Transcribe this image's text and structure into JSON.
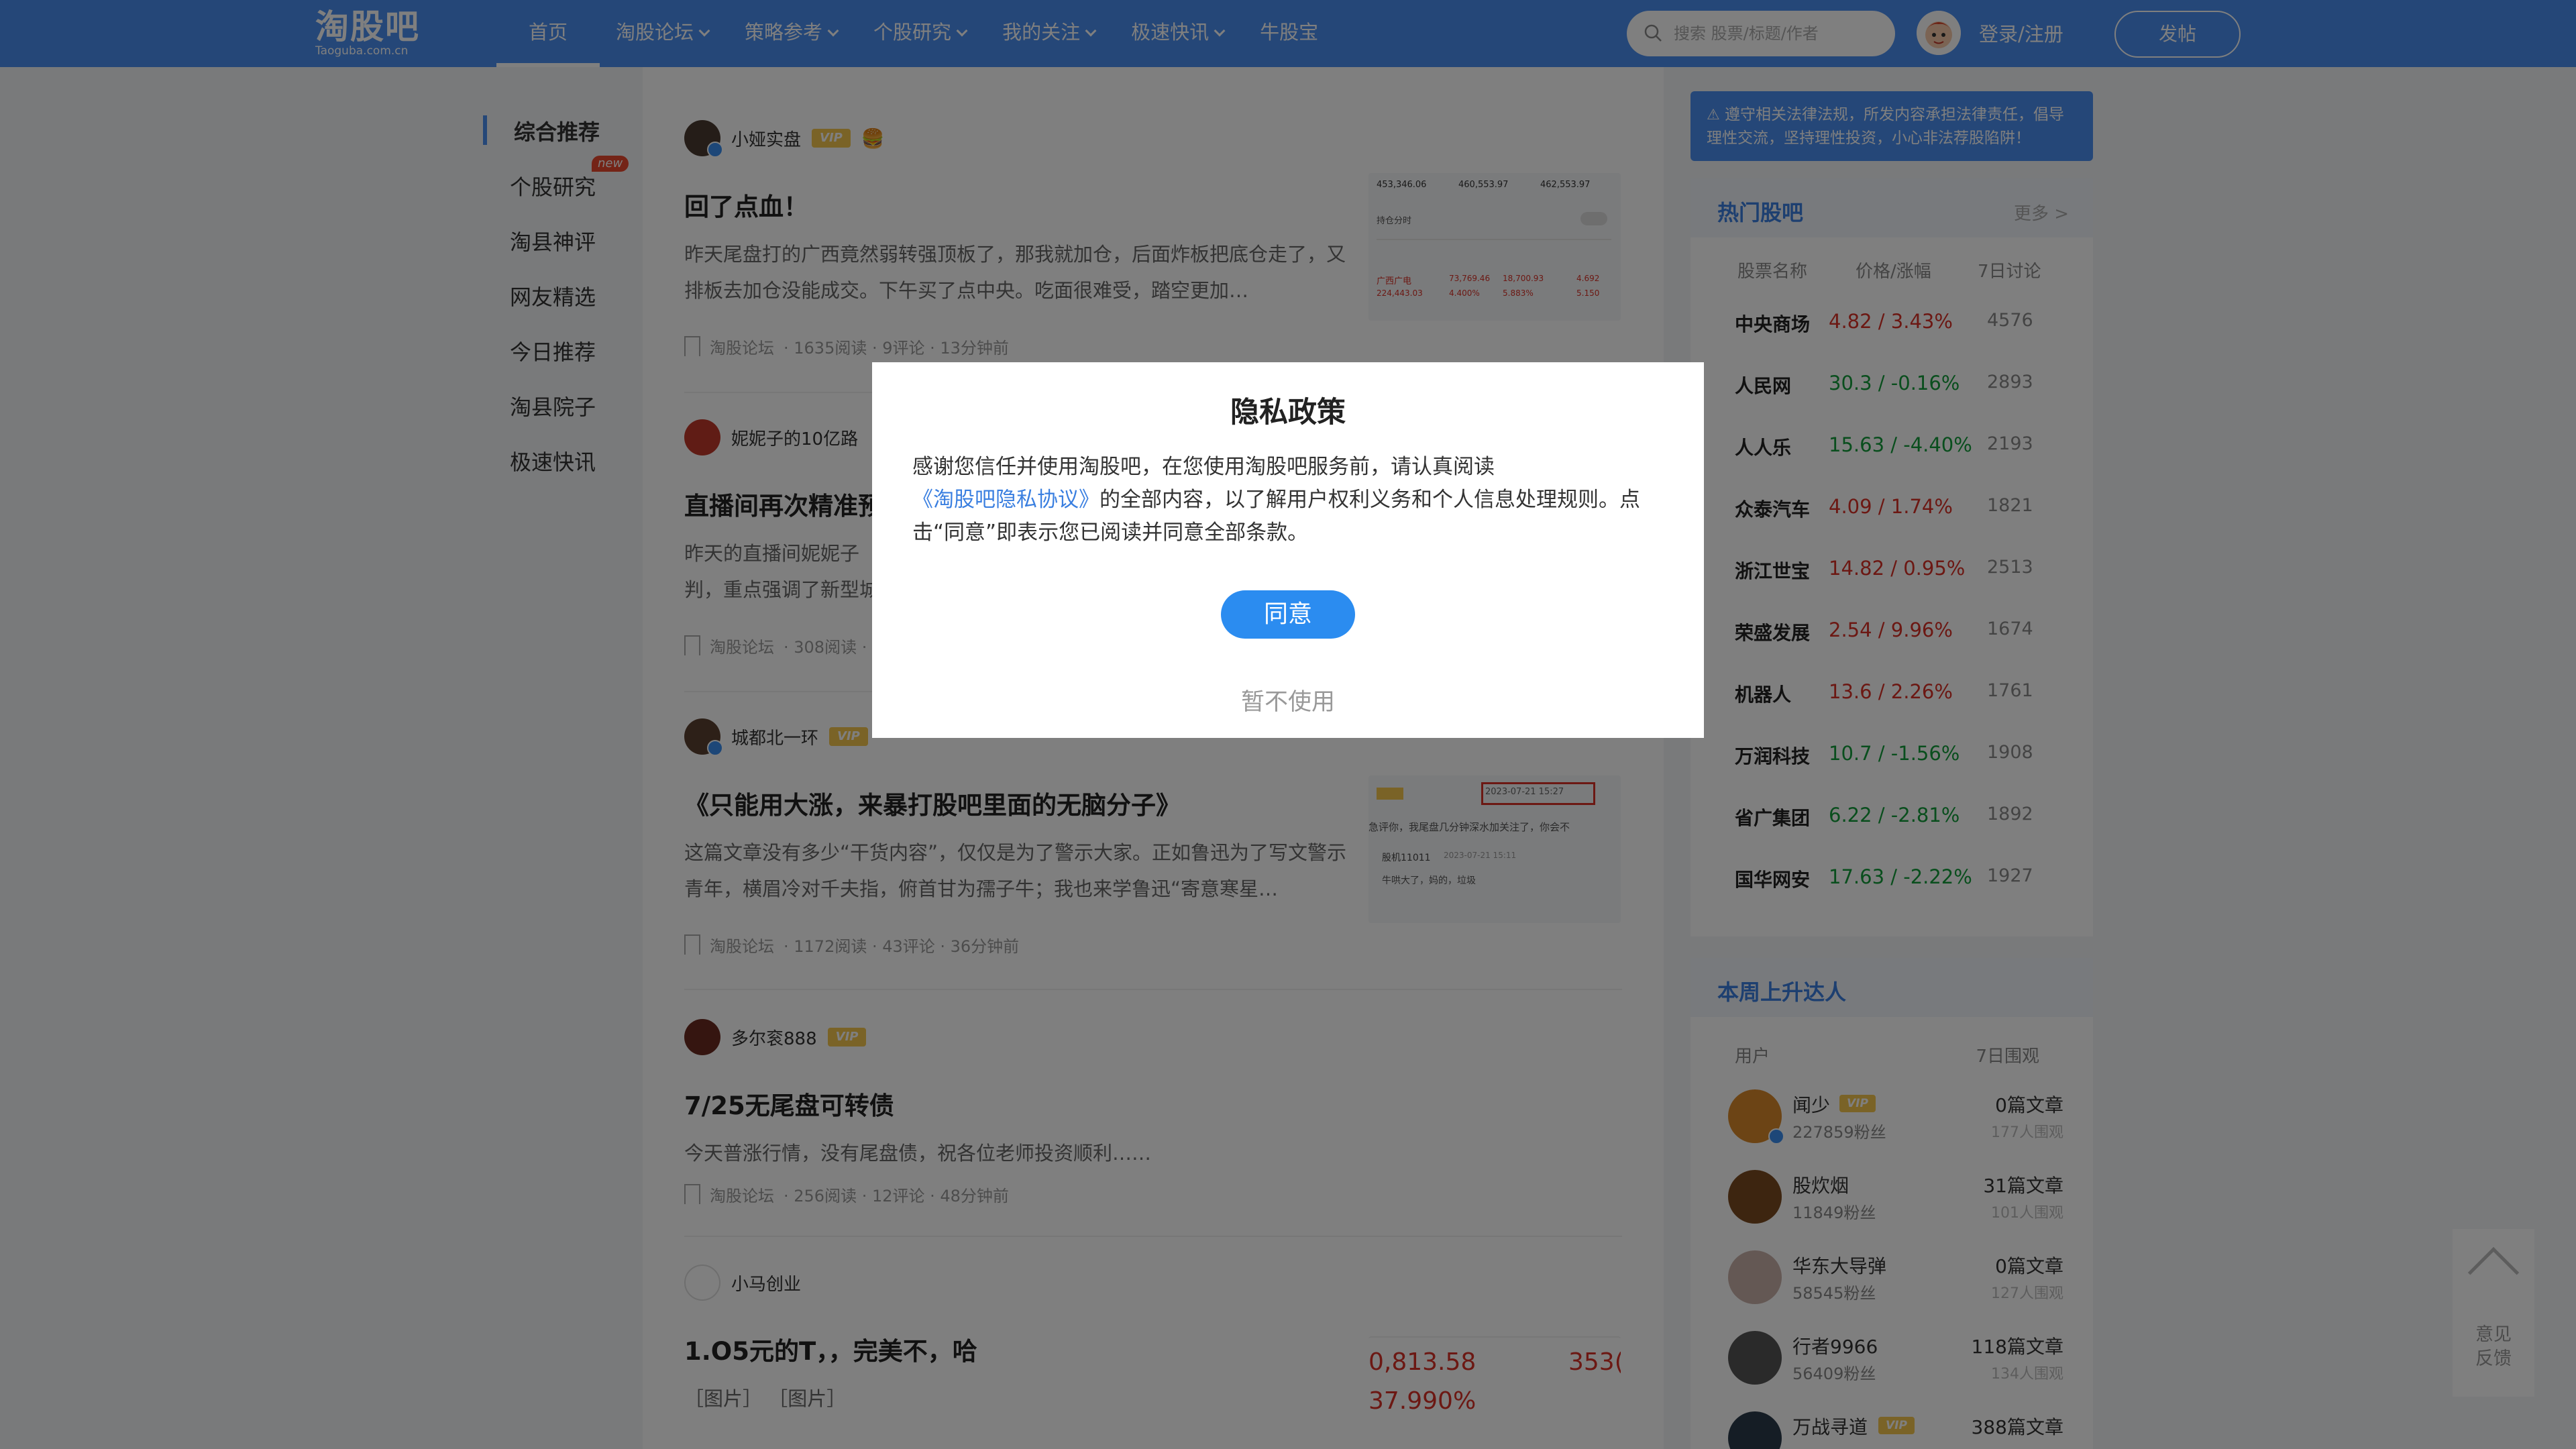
{
  "header": {
    "logo_cn": "淘股吧",
    "logo_en": "Taoguba.com.cn",
    "nav": [
      {
        "label": "首页",
        "dropdown": false
      },
      {
        "label": "淘股论坛",
        "dropdown": true
      },
      {
        "label": "策略参考",
        "dropdown": true
      },
      {
        "label": "个股研究",
        "dropdown": true
      },
      {
        "label": "我的关注",
        "dropdown": true
      },
      {
        "label": "极速快讯",
        "dropdown": true
      },
      {
        "label": "牛股宝",
        "dropdown": false
      }
    ],
    "search_placeholder": "搜索 股票/标题/作者",
    "login": "登录/注册",
    "post_button": "发帖"
  },
  "left_nav": {
    "items": [
      "综合推荐",
      "个股研究",
      "淘县神评",
      "网友精选",
      "今日推荐",
      "淘县院子",
      "极速快讯"
    ],
    "new_badge": "new"
  },
  "feed": {
    "posts": [
      {
        "author": "小娅实盘",
        "vip": "VIP",
        "emoji": "🍔",
        "title": "回了点血！",
        "body": "昨天尾盘打的广西竟然弱转强顶板了，那我就加仓，后面炸板把底仓走了，又排板去加仓没能成交。下午买了点中央。吃面很难受，踏空更加…",
        "meta": [
          "淘股论坛",
          "· 1635阅读 · 9评论 · 13分钟前"
        ]
      },
      {
        "author": "妮妮子的10亿路",
        "vip": "",
        "emoji": "",
        "title": "直播间再次精准预",
        "body": "昨天的直播间妮妮子判，重点强调了新型城",
        "meta": [
          "淘股论坛",
          "· 308阅读 ·"
        ]
      },
      {
        "author": "城都北一环",
        "vip": "VIP",
        "emoji": "",
        "title": "《只能用大涨，来暴打股吧里面的无脑分子》",
        "body": "这篇文章没有多少“干货内容”，仅仅是为了警示大家。正如鲁迅为了写文警示青年，横眉冷对千夫指，俯首甘为孺子牛；我也来学鲁迅“寄意寒星…",
        "meta": [
          "淘股论坛",
          "· 1172阅读 · 43评论 · 36分钟前"
        ]
      },
      {
        "author": "多尔衮888",
        "vip": "VIP",
        "emoji": "",
        "title": "7/25无尾盘可转债",
        "body": "今天普涨行情，没有尾盘债，祝各位老师投资顺利……",
        "meta": [
          "淘股论坛",
          "· 256阅读 · 12评论 · 48分钟前"
        ]
      },
      {
        "author": "小马创业",
        "vip": "",
        "emoji": "",
        "title": "1.O5元的T，，完美不，哈",
        "body": "［图片］ ［图片］",
        "meta": []
      }
    ],
    "thumb1": {
      "stats": [
        "453,346.06",
        "460,553.97",
        "462,553.97"
      ],
      "toggle_label": "持仓分时",
      "row_label": "广西广电",
      "row_values": [
        "224,443.03",
        "73,769.46",
        "18,700.93",
        "4.692"
      ],
      "row_pct": [
        "4.400%",
        "5.883%",
        "5.150"
      ]
    },
    "thumb3": {
      "timestamp": "2023-07-21 15:27",
      "line1": "急评你，我尾盘几分钟深水加关注了，你会不",
      "name": "股机11011",
      "line2": "2023-07-21 15:11",
      "line3": "牛哄大了，妈的，垃圾"
    },
    "thumb5": {
      "n1": "0,813.58",
      "n2": "353(",
      "n3": "37.990%"
    }
  },
  "notice": "遵守相关法律法规，所发内容承担法律责任，倡导理性交流，坚持理性投资，小心非法荐股陷阱！",
  "hot_bars": {
    "title": "热门股吧",
    "more": "更多 >",
    "headers": [
      "股票名称",
      "价格/涨幅",
      "7日讨论"
    ],
    "rows": [
      {
        "name": "中央商场",
        "price": "4.82 / 3.43%",
        "dir": "up",
        "disc": "4576"
      },
      {
        "name": "人民网",
        "price": "30.3 / -0.16%",
        "dir": "down",
        "disc": "2893"
      },
      {
        "name": "人人乐",
        "price": "15.63 / -4.40%",
        "dir": "down",
        "disc": "2193"
      },
      {
        "name": "众泰汽车",
        "price": "4.09 / 1.74%",
        "dir": "up",
        "disc": "1821"
      },
      {
        "name": "浙江世宝",
        "price": "14.82 / 0.95%",
        "dir": "up",
        "disc": "2513"
      },
      {
        "name": "荣盛发展",
        "price": "2.54 / 9.96%",
        "dir": "up",
        "disc": "1674"
      },
      {
        "name": "机器人",
        "price": "13.6 / 2.26%",
        "dir": "up",
        "disc": "1761"
      },
      {
        "name": "万润科技",
        "price": "10.7 / -1.56%",
        "dir": "down",
        "disc": "1908"
      },
      {
        "name": "省广集团",
        "price": "6.22 / -2.81%",
        "dir": "down",
        "disc": "1892"
      },
      {
        "name": "国华网安",
        "price": "17.63 / -2.22%",
        "dir": "down",
        "disc": "1927"
      }
    ]
  },
  "rising": {
    "title": "本周上升达人",
    "headers": [
      "用户",
      "7日围观"
    ],
    "users": [
      {
        "name": "闻少",
        "vip": "VIP",
        "fans": "227859粉丝",
        "articles": "0篇文章",
        "views": "177人围观"
      },
      {
        "name": "股炊烟",
        "vip": "",
        "fans": "11849粉丝",
        "articles": "31篇文章",
        "views": "101人围观"
      },
      {
        "name": "华东大导弹",
        "vip": "",
        "fans": "58545粉丝",
        "articles": "0篇文章",
        "views": "127人围观"
      },
      {
        "name": "行者9966",
        "vip": "",
        "fans": "56409粉丝",
        "articles": "118篇文章",
        "views": "134人围观"
      },
      {
        "name": "万战寻道",
        "vip": "VIP",
        "fans": "",
        "articles": "388篇文章",
        "views": ""
      }
    ]
  },
  "feedback": [
    "意见",
    "反馈"
  ],
  "modal": {
    "title": "隐私政策",
    "body_1": "感谢您信任并使用淘股吧，在您使用淘股吧服务前，请认真阅读",
    "link": "《淘股吧隐私协议》",
    "body_2": "的全部内容，以了解用户权利义务和个人信息处理规则。点击“同意”即表示您已阅读并同意全部条款。",
    "agree": "同意",
    "decline": "暂不使用"
  },
  "colors": {
    "brand": "#4a8ef0",
    "up": "#d93026",
    "down": "#139d3a",
    "vip": "#f4c64e",
    "link": "#3a7fe0"
  }
}
